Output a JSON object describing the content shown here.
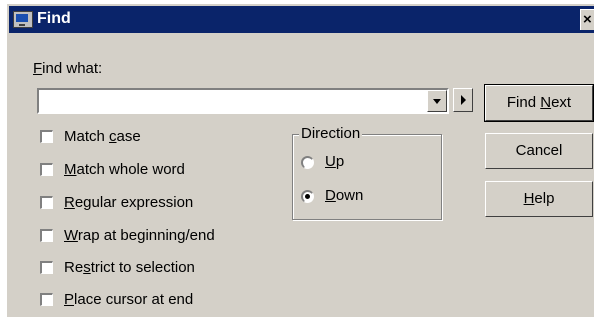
{
  "window": {
    "title": "Find",
    "icon": "monitor-icon",
    "close_glyph": "×"
  },
  "find_what": {
    "label_hot": "F",
    "label_rest": "ind what:",
    "value": "",
    "dropdown_icon": "chevron-down-icon",
    "arrow_icon": "triangle-right-icon"
  },
  "buttons": {
    "find_next_pre": "Find ",
    "find_next_hot": "N",
    "find_next_post": "ext",
    "cancel": "Cancel",
    "help_hot": "H",
    "help_rest": "elp"
  },
  "options": [
    {
      "pre": "Match ",
      "hot": "c",
      "post": "ase",
      "checked": false
    },
    {
      "pre": "",
      "hot": "M",
      "post": "atch whole word",
      "checked": false
    },
    {
      "pre": "",
      "hot": "R",
      "post": "egular expression",
      "checked": false
    },
    {
      "pre": "",
      "hot": "W",
      "post": "rap at beginning/end",
      "checked": false
    },
    {
      "pre": "Re",
      "hot": "s",
      "post": "trict to selection",
      "checked": false
    },
    {
      "pre": "",
      "hot": "P",
      "post": "lace cursor at end",
      "checked": false
    }
  ],
  "direction": {
    "title": "Direction",
    "up_hot": "U",
    "up_rest": "p",
    "down_hot": "D",
    "down_rest": "own",
    "selected": "Down"
  }
}
